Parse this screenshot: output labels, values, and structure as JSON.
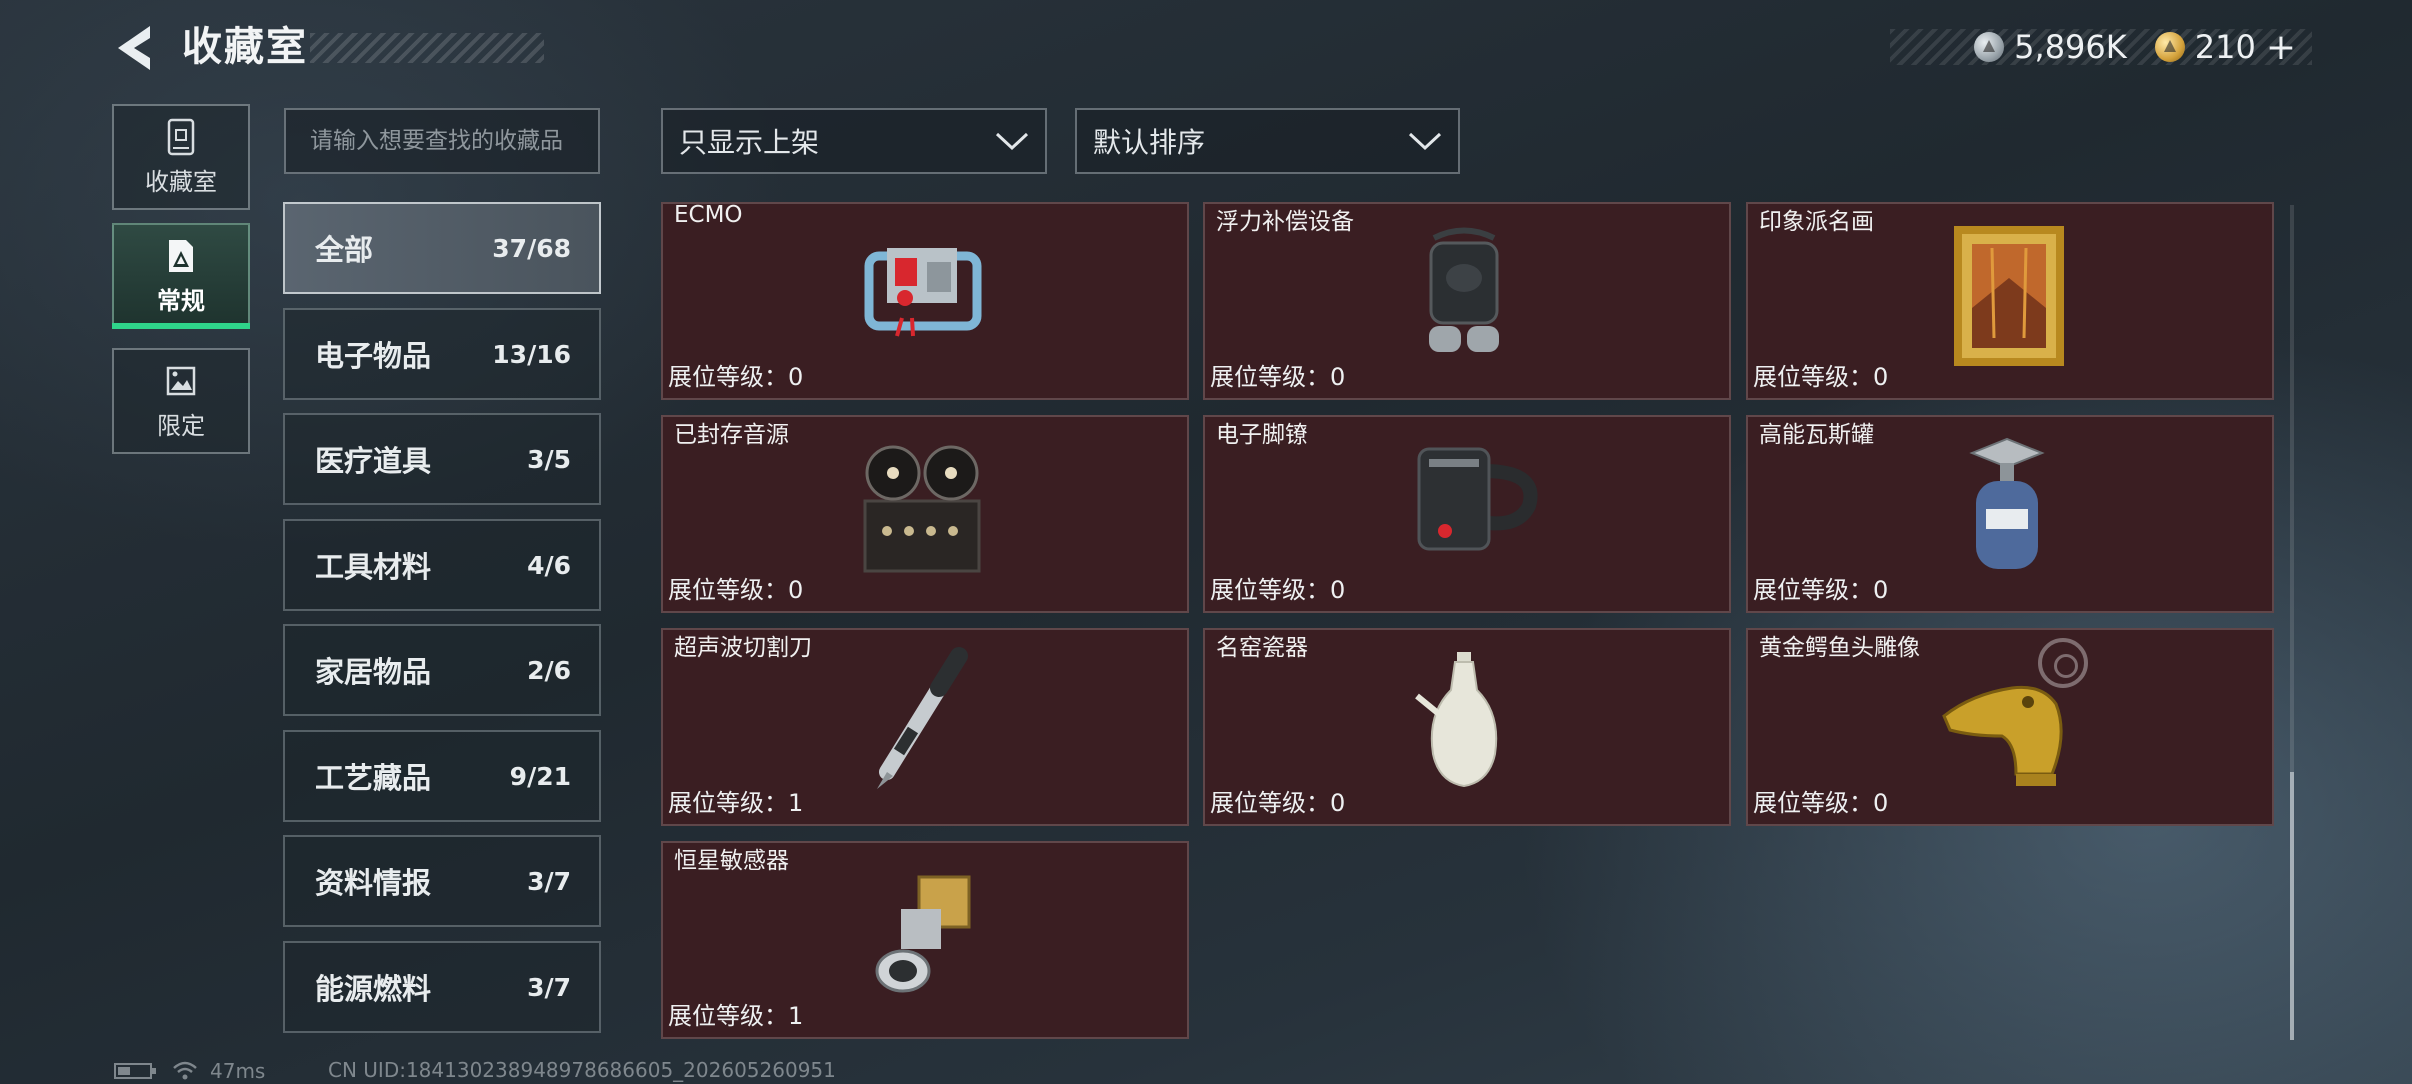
{
  "header": {
    "title": "收藏室",
    "currencies": [
      {
        "icon": "silver-coin-icon",
        "value": "5,896K"
      },
      {
        "icon": "gold-coin-icon",
        "value": "210",
        "plus": "+"
      }
    ]
  },
  "nav_tabs": [
    {
      "label": "收藏室",
      "icon": "cabinet-icon"
    },
    {
      "label": "常规",
      "icon": "warning-frame-icon",
      "active": true
    },
    {
      "label": "限定",
      "icon": "landscape-frame-icon"
    }
  ],
  "search": {
    "placeholder": "请输入想要查找的收藏品"
  },
  "filters": {
    "display": "只显示上架",
    "sort": "默认排序"
  },
  "categories": [
    {
      "name": "全部",
      "count": "37/68",
      "active": true
    },
    {
      "name": "电子物品",
      "count": "13/16"
    },
    {
      "name": "医疗道具",
      "count": "3/5"
    },
    {
      "name": "工具材料",
      "count": "4/6"
    },
    {
      "name": "家居物品",
      "count": "2/6"
    },
    {
      "name": "工艺藏品",
      "count": "9/21"
    },
    {
      "name": "资料情报",
      "count": "3/7"
    },
    {
      "name": "能源燃料",
      "count": "3/7"
    }
  ],
  "items": [
    {
      "name": "ECMO",
      "level": "展位等级：0",
      "icon": "ecmo-machine-icon"
    },
    {
      "name": "浮力补偿设备",
      "level": "展位等级：0",
      "icon": "buoyancy-device-icon"
    },
    {
      "name": "印象派名画",
      "level": "展位等级：0",
      "icon": "framed-painting-icon"
    },
    {
      "name": "已封存音源",
      "level": "展位等级：0",
      "icon": "reel-recorder-icon"
    },
    {
      "name": "电子脚镣",
      "level": "展位等级：0",
      "icon": "ankle-monitor-icon"
    },
    {
      "name": "高能瓦斯罐",
      "level": "展位等级：0",
      "icon": "gas-canister-icon"
    },
    {
      "name": "超声波切割刀",
      "level": "展位等级：1",
      "icon": "ultrasonic-cutter-icon"
    },
    {
      "name": "名窑瓷器",
      "level": "展位等级：0",
      "icon": "porcelain-ewer-icon"
    },
    {
      "name": "黄金鳄鱼头雕像",
      "level": "展位等级：0",
      "icon": "gold-crocodile-statue-icon"
    },
    {
      "name": "恒星敏感器",
      "level": "展位等级：1",
      "icon": "star-sensor-icon"
    }
  ],
  "status": {
    "latency": "47ms",
    "uid": "CN UID:18413023894897868660​5_202605260951"
  }
}
